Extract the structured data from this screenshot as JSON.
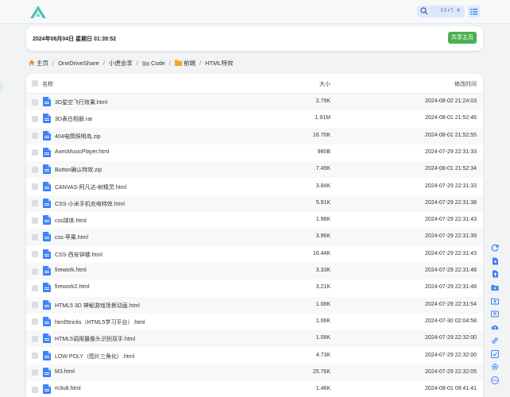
{
  "colors": {
    "accent": "#3b82f6",
    "share_button": "#4caf50",
    "logo": "#4fc3b6",
    "folder": "#f5a623"
  },
  "topbar": {
    "search_shortcut": "Ctrl K",
    "icons": [
      "logo-icon",
      "search-icon",
      "menu-list-icon"
    ]
  },
  "datebar": {
    "datetime": "2024年08月04日 星期日 01:39:52",
    "share_label": "共享主页"
  },
  "breadcrumb": [
    {
      "label": "主页",
      "icon": "home-icon"
    },
    {
      "label": "OneDriveShare"
    },
    {
      "label": "小虎会享"
    },
    {
      "label": "Code",
      "icon": "folder-icon"
    },
    {
      "label": "前端",
      "icon": "folder-icon"
    },
    {
      "label": "HTML特效"
    }
  ],
  "table": {
    "headers": {
      "name": "名称",
      "size": "大小",
      "time": "修改时间"
    },
    "rows": [
      {
        "name": "3D星空飞行效果.html",
        "size": "2.79K",
        "time": "2024-08-02 21:24:03"
      },
      {
        "name": "3D表白相册.rar",
        "size": "1.91M",
        "time": "2024-08-01 21:52:46"
      },
      {
        "name": "404电筒照明岛.zip",
        "size": "16.70K",
        "time": "2024-08-01 21:52:55"
      },
      {
        "name": "AxesMusicPlayer.html",
        "size": "960B",
        "time": "2024-07-29 22:31:33"
      },
      {
        "name": "Button确认特效.zip",
        "size": "7.49K",
        "time": "2024-08-01 21:52:34"
      },
      {
        "name": "CANVAS-阿凡达-树精灵.html",
        "size": "3.84K",
        "time": "2024-07-29 22:31:33"
      },
      {
        "name": "CSS-小米手机充电特效.html",
        "size": "5.91K",
        "time": "2024-07-29 22:31:38"
      },
      {
        "name": "css球体.html",
        "size": "1.98K",
        "time": "2024-07-29 22:31:43"
      },
      {
        "name": "css-苹果.html",
        "size": "3.96K",
        "time": "2024-07-29 22:31:39"
      },
      {
        "name": "CSS-西安钟楼.html",
        "size": "16.44K",
        "time": "2024-07-29 22:31:43"
      },
      {
        "name": "firework.html",
        "size": "3.33K",
        "time": "2024-07-29 22:31:48"
      },
      {
        "name": "firework2.html",
        "size": "3.21K",
        "time": "2024-07-29 22:31:48"
      },
      {
        "name": "HTML5 3D 神秘游戏场景动画.html",
        "size": "1.08K",
        "time": "2024-07-29 22:31:54"
      },
      {
        "name": "html5tricks（HTML5学习平台）.html",
        "size": "1.06K",
        "time": "2024-07-30 02:04:58"
      },
      {
        "name": "HTML5调用摄像头识别双手.html",
        "size": "1.08K",
        "time": "2024-07-29 22:32:00"
      },
      {
        "name": "LOW POLY（图片三角化）.html",
        "size": "4.73K",
        "time": "2024-07-29 22:32:00"
      },
      {
        "name": "M3.html",
        "size": "25.76K",
        "time": "2024-07-29 22:32:05"
      },
      {
        "name": "m3u8.html",
        "size": "1.46K",
        "time": "2024-08-01 09:41:41"
      }
    ]
  },
  "side_tools": [
    "refresh-icon",
    "new-file-icon",
    "upload-file-icon",
    "new-folder-icon",
    "upload-folder-icon",
    "download-icon",
    "cloud-upload-icon",
    "link-icon",
    "checklist-icon",
    "settings-icon",
    "more-icon"
  ]
}
